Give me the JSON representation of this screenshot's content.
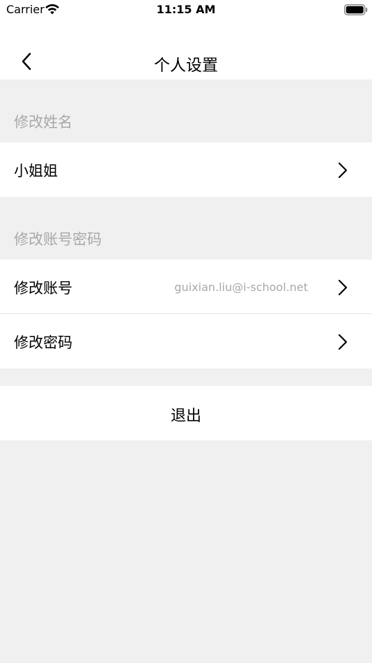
{
  "status_bar": {
    "carrier": "Carrier",
    "time": "11:15 AM"
  },
  "nav": {
    "title": "个人设置"
  },
  "sections": {
    "name": {
      "header": "修改姓名",
      "row_label": "小姐姐"
    },
    "account": {
      "header": "修改账号密码",
      "account_label": "修改账号",
      "account_value": "guixian.liu@i-school.net",
      "password_label": "修改密码"
    }
  },
  "logout_label": "退出"
}
